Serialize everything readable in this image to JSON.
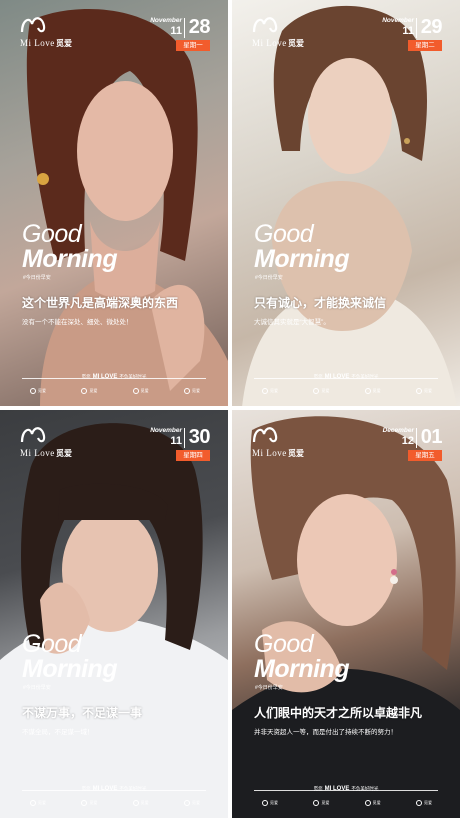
{
  "brand": {
    "name": "Mi Love",
    "cn": "觅爱",
    "footer": "MI LOVE"
  },
  "accent": "#f25c2c",
  "posters": [
    {
      "month": "November",
      "mnum": "11",
      "day": "28",
      "weekday": "星期一",
      "good": "Good",
      "morning": "Morning",
      "sub": "#今日份早安",
      "headline": "这个世界凡是高端深奥的东西",
      "slogan": "没有一个不能在深处、细处、微处处！",
      "footer_pre": "觅您",
      "footer_post": "不负美好时光",
      "icons": [
        "觅爱",
        "觅爱",
        "觅爱",
        "觅爱"
      ]
    },
    {
      "month": "November",
      "mnum": "11",
      "day": "29",
      "weekday": "星期二",
      "good": "Good",
      "morning": "Morning",
      "sub": "#今日份早安",
      "headline": "只有诚心，才能换来诚信",
      "slogan": "大诚信其实就是“大智慧”。",
      "footer_pre": "觅您",
      "footer_post": "不负美好时光",
      "icons": [
        "觅爱",
        "觅爱",
        "觅爱",
        "觅爱"
      ]
    },
    {
      "month": "November",
      "mnum": "11",
      "day": "30",
      "weekday": "星期四",
      "good": "Good",
      "morning": "Morning",
      "sub": "#今日份早安",
      "headline": "不谋万事，不足谋一事",
      "slogan": "不谋全局，不足谋一域！",
      "footer_pre": "觅您",
      "footer_post": "不负美好时光",
      "icons": [
        "觅爱",
        "觅爱",
        "觅爱",
        "觅爱"
      ]
    },
    {
      "month": "December",
      "mnum": "12",
      "day": "01",
      "weekday": "星期五",
      "good": "Good",
      "morning": "Morning",
      "sub": "#今日份早安",
      "headline": "人们眼中的天才之所以卓越非凡",
      "slogan": "并非天资超人一等，而是付出了持续不断的努力！",
      "footer_pre": "觅您",
      "footer_post": "不负美好时光",
      "icons": [
        "觅爱",
        "觅爱",
        "觅爱",
        "觅爱"
      ]
    }
  ]
}
